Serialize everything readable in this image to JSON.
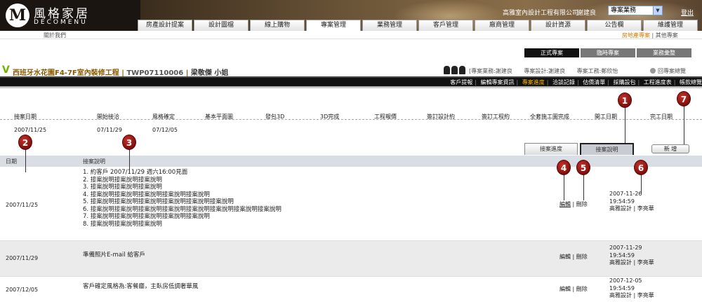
{
  "brand": {
    "logo_title": "風格家居",
    "logo_sub": "DECOMENU",
    "logo_mark": "M"
  },
  "header": {
    "company": "高雅室內設計工程有限公司",
    "user": "謝建良",
    "role_select": "專案業務",
    "logout": "登出"
  },
  "main_tabs": [
    {
      "label": "房產設計提案"
    },
    {
      "label": "設計圖檔"
    },
    {
      "label": "線上購物"
    },
    {
      "label": "專案管理"
    },
    {
      "label": "業務管理"
    },
    {
      "label": "客戶管理"
    },
    {
      "label": "廠商管理"
    },
    {
      "label": "設計資源"
    },
    {
      "label": "公告欄"
    },
    {
      "label": "維護管理"
    }
  ],
  "subbar": {
    "about": "關於我們",
    "realty": "房地產專案",
    "other": "其他專案",
    "sep": "|"
  },
  "project_tabs": [
    "正式專案",
    "臨時專案",
    "業務彙整"
  ],
  "project": {
    "v_mark": "V",
    "name": "西班牙水花園F4-7F室內裝修工程",
    "code": "TWP07110006",
    "client": "梁敬傑 小姐",
    "sep": "|"
  },
  "contacts": {
    "sales": "[專案業務:謝建良",
    "designer": "專案設計:謝建良",
    "engineer": "專案工務:鄭欣怡",
    "back": "回專案總覽"
  },
  "func_menu": [
    {
      "label": "客戶提報"
    },
    {
      "label": "編輯專案資訊"
    },
    {
      "label": "專案進度",
      "active": true
    },
    {
      "label": "洽談記錄"
    },
    {
      "label": "估價清單"
    },
    {
      "label": "採購設包"
    },
    {
      "label": "工程進度表"
    },
    {
      "label": "帳款總覽"
    }
  ],
  "progress": {
    "headers": [
      "接案日期",
      "開始接洽",
      "風格確定",
      "基本平面圖",
      "發包3D",
      "3D完成",
      "工程報價",
      "簽訂設計約",
      "簽訂工程約",
      "全套施工圖完成",
      "開工日期",
      "完工日期"
    ],
    "values": [
      "2007/11/25",
      "07/11/29",
      "07/12/05"
    ]
  },
  "sub_tabs": {
    "progress": "接案進度",
    "notes": "接案說明",
    "add": "新 增"
  },
  "notes_table": {
    "headers": {
      "date": "日期",
      "desc": "接案說明"
    },
    "edit": "編輯",
    "delete": "刪除",
    "sep": "|",
    "rows": [
      {
        "date": "2007/11/25",
        "lines": [
          "1. 約客戶 2007/11/29 週六16:00見面",
          "2. 接案說明接案說明接案說明",
          "3. 接案說明接案說明接案說明",
          "4. 接案說明接案說明接案說明接案說明接案說明",
          "5. 接案說明接案說明接案說明接案說明接案說明接案說明",
          "6. 接案說明接案說明接案說明接案說明接案說明接案說明接案說明接案說明",
          "7. 接案說明接案說明接案說明接案說明接案說明",
          "8. 接案說明接案說明接案說明"
        ],
        "ts_date": "2007-11-26",
        "ts_time": "19:54:59",
        "author": "高雅設計 | 李亮華"
      },
      {
        "date": "2007/11/29",
        "lines": [
          "準備照片E-mail 給客戶"
        ],
        "ts_date": "2007-11-29",
        "ts_time": "19:54:59",
        "author": "高雅設計 | 李亮華"
      },
      {
        "date": "2007/12/05",
        "lines": [
          "客戶確定風格為:客餐廳，主臥房低調奢華風"
        ],
        "ts_date": "2007-12-05",
        "ts_time": "19:54:59",
        "author": "高雅設計 | 李亮華"
      }
    ]
  },
  "markers": [
    "1",
    "2",
    "3",
    "4",
    "5",
    "6",
    "7"
  ],
  "colors": {
    "marker_red": "#9b1712",
    "active_orange": "#ffb800",
    "project_brown": "#8b5a00",
    "v_green": "#6fb300"
  }
}
